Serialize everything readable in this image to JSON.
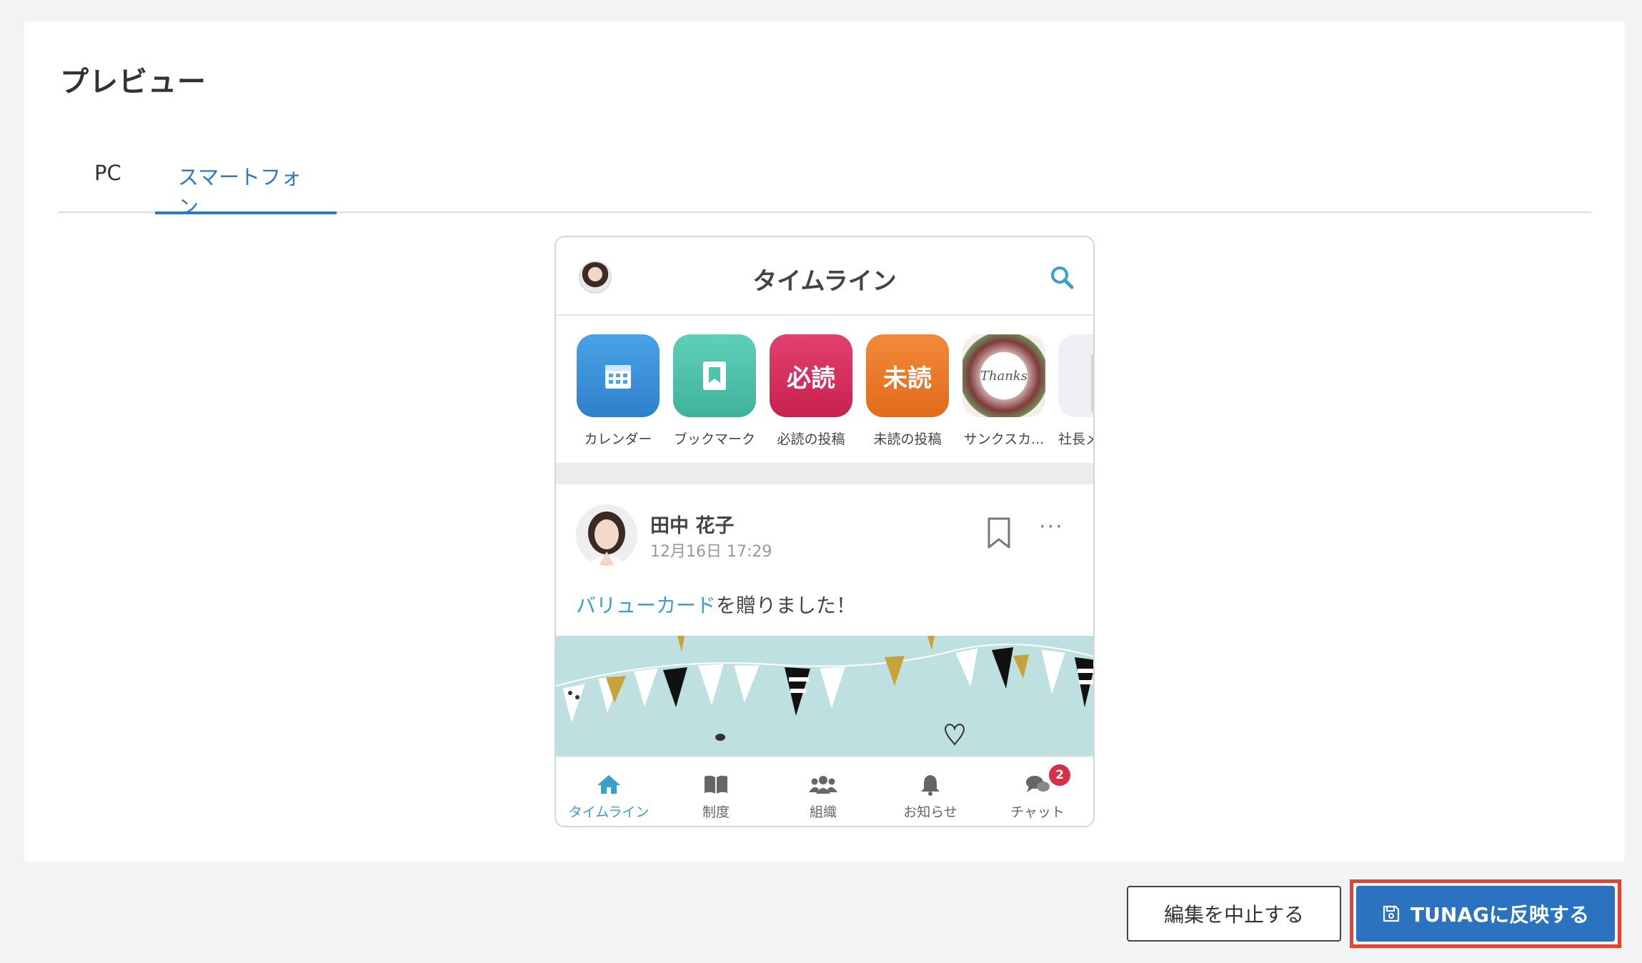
{
  "page": {
    "title": "プレビュー",
    "tabs": [
      {
        "label": "PC",
        "active": false
      },
      {
        "label": "スマートフォン",
        "active": true
      }
    ]
  },
  "phone": {
    "header_title": "タイムライン",
    "shortcuts": [
      {
        "label": "カレンダー",
        "icon": "calendar-icon",
        "color": "#3a8fd8",
        "text": ""
      },
      {
        "label": "ブックマーク",
        "icon": "bookmark-icon",
        "color": "#4fc4ad",
        "text": ""
      },
      {
        "label": "必読の投稿",
        "icon": "must-read-icon",
        "color": "#d92e62",
        "text": "必読"
      },
      {
        "label": "未読の投稿",
        "icon": "unread-icon",
        "color": "#ee7a2a",
        "text": "未読"
      },
      {
        "label": "サンクスカ...",
        "icon": "thanks-card-icon",
        "color": "#f4efe6",
        "text": "Thanks"
      },
      {
        "label": "社長メ",
        "icon": "president-icon",
        "color": "#eef0f4",
        "text": ""
      }
    ],
    "post": {
      "author": "田中 花子",
      "date": "12月16日 17:29",
      "link_text": "バリューカード",
      "text_suffix": "を贈りました！"
    },
    "tabbar": [
      {
        "label": "タイムライン",
        "icon": "home-icon",
        "active": true
      },
      {
        "label": "制度",
        "icon": "book-icon",
        "active": false
      },
      {
        "label": "組織",
        "icon": "users-icon",
        "active": false
      },
      {
        "label": "お知らせ",
        "icon": "bell-icon",
        "active": false
      },
      {
        "label": "チャット",
        "icon": "chat-icon",
        "active": false,
        "badge": "2"
      }
    ]
  },
  "actions": {
    "cancel_label": "編集を中止する",
    "save_label": "TUNAGに反映する"
  },
  "colors": {
    "accent": "#2a7ac4",
    "save_button": "#2b73c0",
    "highlight": "#e2452d",
    "link": "#3a9fc9"
  }
}
